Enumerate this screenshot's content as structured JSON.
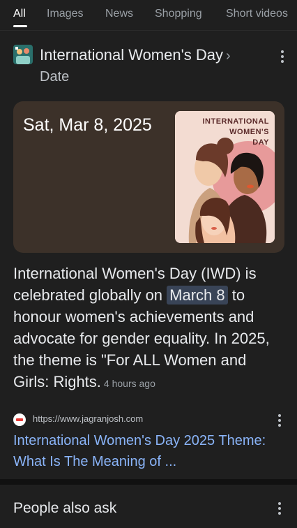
{
  "tabs": [
    {
      "label": "All",
      "active": true
    },
    {
      "label": "Images"
    },
    {
      "label": "News"
    },
    {
      "label": "Shopping"
    },
    {
      "label": "Short videos"
    }
  ],
  "knowledge": {
    "title": "International Women's Day",
    "chevron": "›",
    "subtitle": "Date"
  },
  "card": {
    "date": "Sat, Mar 8, 2025",
    "image_text_1": "INTERNATIONAL",
    "image_text_2": "WOMEN'S",
    "image_text_3": "DAY"
  },
  "snippet": {
    "before": "International Women's Day (IWD) is celebrated globally on ",
    "highlight": "March 8",
    "after": " to honour women's achievements and advocate for gender equality. In 2025, the theme is \"For ALL Women and Girls: Rights.",
    "time": "4 hours ago"
  },
  "source": {
    "url": "https://www.jagranjosh.com",
    "link_text": "International Women's Day 2025 Theme: What Is The Meaning of ..."
  },
  "people_also_ask": {
    "label": "People also ask"
  }
}
